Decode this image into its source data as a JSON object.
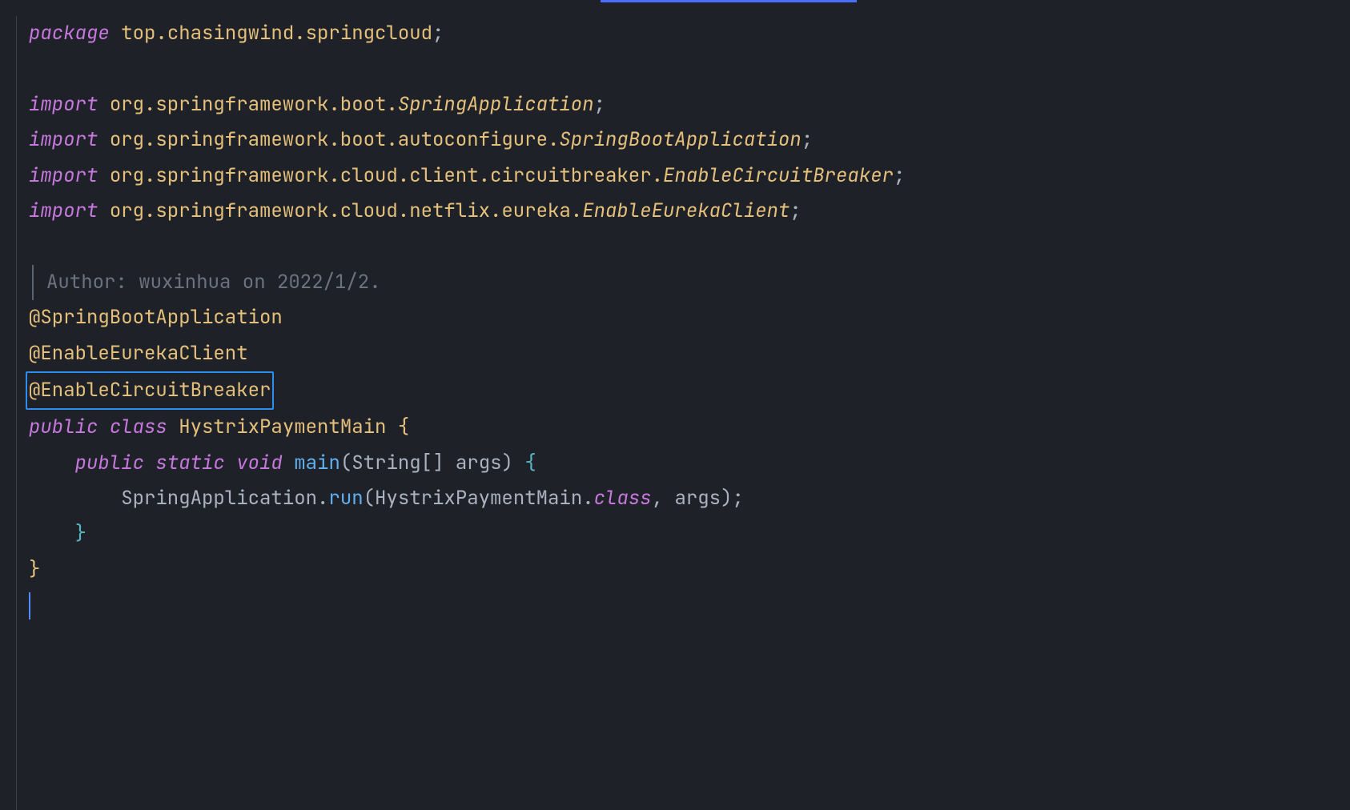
{
  "code": {
    "package_kw": "package",
    "package_path": "top.chasingwind.springcloud",
    "import_kw": "import",
    "imports": [
      {
        "path": "org.springframework.boot.",
        "cls": "SpringApplication"
      },
      {
        "path": "org.springframework.boot.autoconfigure.",
        "cls": "SpringBootApplication"
      },
      {
        "path": "org.springframework.cloud.client.circuitbreaker.",
        "cls": "EnableCircuitBreaker"
      },
      {
        "path": "org.springframework.cloud.netflix.eureka.",
        "cls": "EnableEurekaClient"
      }
    ],
    "doc_comment": "Author: wuxinhua on 2022/1/2.",
    "annotations": [
      "@SpringBootApplication",
      "@EnableEurekaClient",
      "@EnableCircuitBreaker"
    ],
    "kw_public": "public",
    "kw_class": "class",
    "kw_static": "static",
    "kw_void": "void",
    "class_name": "HystrixPaymentMain",
    "method_name": "main",
    "param_type": "String",
    "param_name": "args",
    "call_obj": "SpringApplication",
    "call_method": "run",
    "call_arg_class": "HystrixPaymentMain",
    "kw_class_ref": "class",
    "call_arg2": "args",
    "semicolon": ";",
    "open_brace": "{",
    "close_brace": "}",
    "brackets": "[]",
    "paren_open": "(",
    "paren_close": ")",
    "comma": ",",
    "dot": "."
  }
}
